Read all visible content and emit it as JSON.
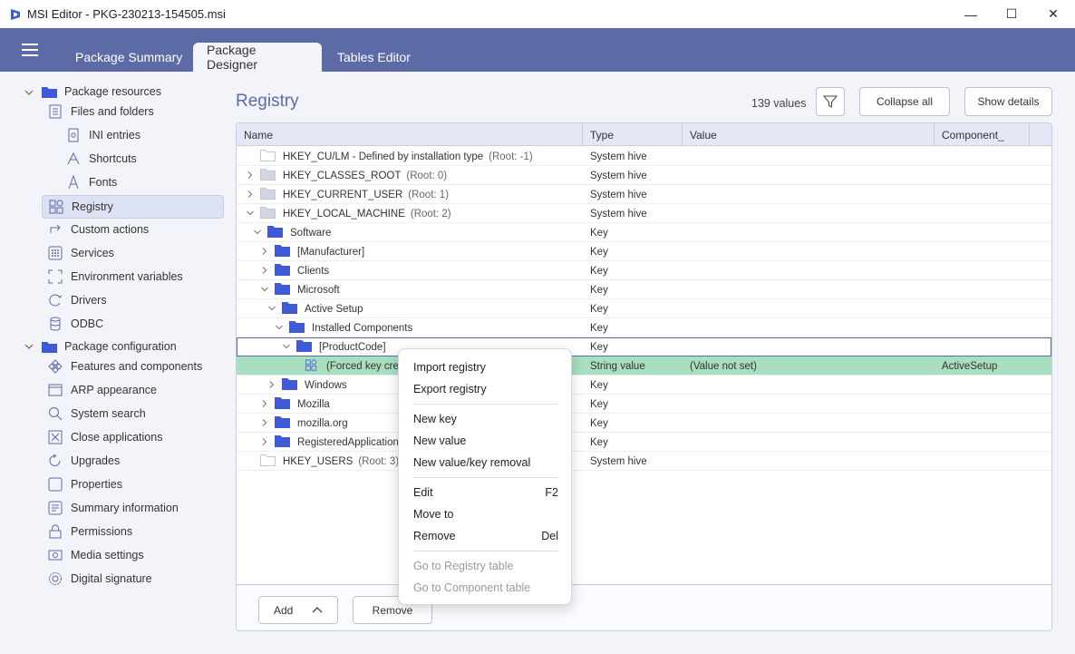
{
  "window": {
    "title": "MSI Editor - PKG-230213-154505.msi",
    "minimize": "—",
    "maximize": "☐",
    "close": "✕"
  },
  "tabs": [
    {
      "label": "Package Summary"
    },
    {
      "label": "Package Designer"
    },
    {
      "label": "Tables Editor"
    }
  ],
  "sidebar": {
    "resources_group": "Package resources",
    "resources": [
      "Files and folders",
      "INI entries",
      "Shortcuts",
      "Fonts",
      "Registry",
      "Custom actions",
      "Services",
      "Environment variables",
      "Drivers",
      "ODBC"
    ],
    "config_group": "Package configuration",
    "config": [
      "Features and components",
      "ARP appearance",
      "System search",
      "Close applications",
      "Upgrades",
      "Properties",
      "Summary information",
      "Permissions",
      "Media settings",
      "Digital signature"
    ]
  },
  "main": {
    "title": "Registry",
    "count": "139 values",
    "collapse_label": "Collapse all",
    "details_label": "Show details",
    "columns": [
      "Name",
      "Type",
      "Value",
      "Component_"
    ],
    "rows": [
      {
        "name": "HKEY_CU/LM - Defined by installation type",
        "sub": "(Root: -1)",
        "type": "System hive",
        "value": "",
        "component": ""
      },
      {
        "name": "HKEY_CLASSES_ROOT",
        "sub": "(Root: 0)",
        "type": "System hive",
        "value": "",
        "component": ""
      },
      {
        "name": "HKEY_CURRENT_USER",
        "sub": "(Root: 1)",
        "type": "System hive",
        "value": "",
        "component": ""
      },
      {
        "name": "HKEY_LOCAL_MACHINE",
        "sub": "(Root: 2)",
        "type": "System hive",
        "value": "",
        "component": ""
      },
      {
        "name": "Software",
        "sub": "",
        "type": "Key",
        "value": "",
        "component": ""
      },
      {
        "name": "[Manufacturer]",
        "sub": "",
        "type": "Key",
        "value": "",
        "component": ""
      },
      {
        "name": "Clients",
        "sub": "",
        "type": "Key",
        "value": "",
        "component": ""
      },
      {
        "name": "Microsoft",
        "sub": "",
        "type": "Key",
        "value": "",
        "component": ""
      },
      {
        "name": "Active Setup",
        "sub": "",
        "type": "Key",
        "value": "",
        "component": ""
      },
      {
        "name": "Installed Components",
        "sub": "",
        "type": "Key",
        "value": "",
        "component": ""
      },
      {
        "name": "[ProductCode]",
        "sub": "",
        "type": "Key",
        "value": "",
        "component": ""
      },
      {
        "name": "(Forced key crea",
        "sub": "",
        "type": "String value",
        "value": "(Value not set)",
        "component": "ActiveSetup"
      },
      {
        "name": "Windows",
        "sub": "",
        "type": "Key",
        "value": "",
        "component": ""
      },
      {
        "name": "Mozilla",
        "sub": "",
        "type": "Key",
        "value": "",
        "component": ""
      },
      {
        "name": "mozilla.org",
        "sub": "",
        "type": "Key",
        "value": "",
        "component": ""
      },
      {
        "name": "RegisteredApplications",
        "sub": "",
        "type": "Key",
        "value": "",
        "component": ""
      },
      {
        "name": "HKEY_USERS",
        "sub": "(Root: 3)",
        "type": "System hive",
        "value": "",
        "component": ""
      }
    ],
    "add_label": "Add",
    "remove_label": "Remove"
  },
  "context_menu": {
    "items": [
      {
        "label": "Import registry",
        "shortcut": ""
      },
      {
        "label": "Export registry",
        "shortcut": ""
      },
      {
        "label": "New key",
        "shortcut": ""
      },
      {
        "label": "New value",
        "shortcut": ""
      },
      {
        "label": "New value/key removal",
        "shortcut": ""
      },
      {
        "label": "Edit",
        "shortcut": "F2"
      },
      {
        "label": "Move to",
        "shortcut": ""
      },
      {
        "label": "Remove",
        "shortcut": "Del"
      },
      {
        "label": "Go to Registry table",
        "shortcut": ""
      },
      {
        "label": "Go to Component table",
        "shortcut": ""
      }
    ]
  },
  "colors": {
    "accent": "#5c6aa6",
    "highlight_row": "#a7dfbf",
    "folder": "#3f5ad6",
    "hive_folder": "#d3d6e2"
  }
}
